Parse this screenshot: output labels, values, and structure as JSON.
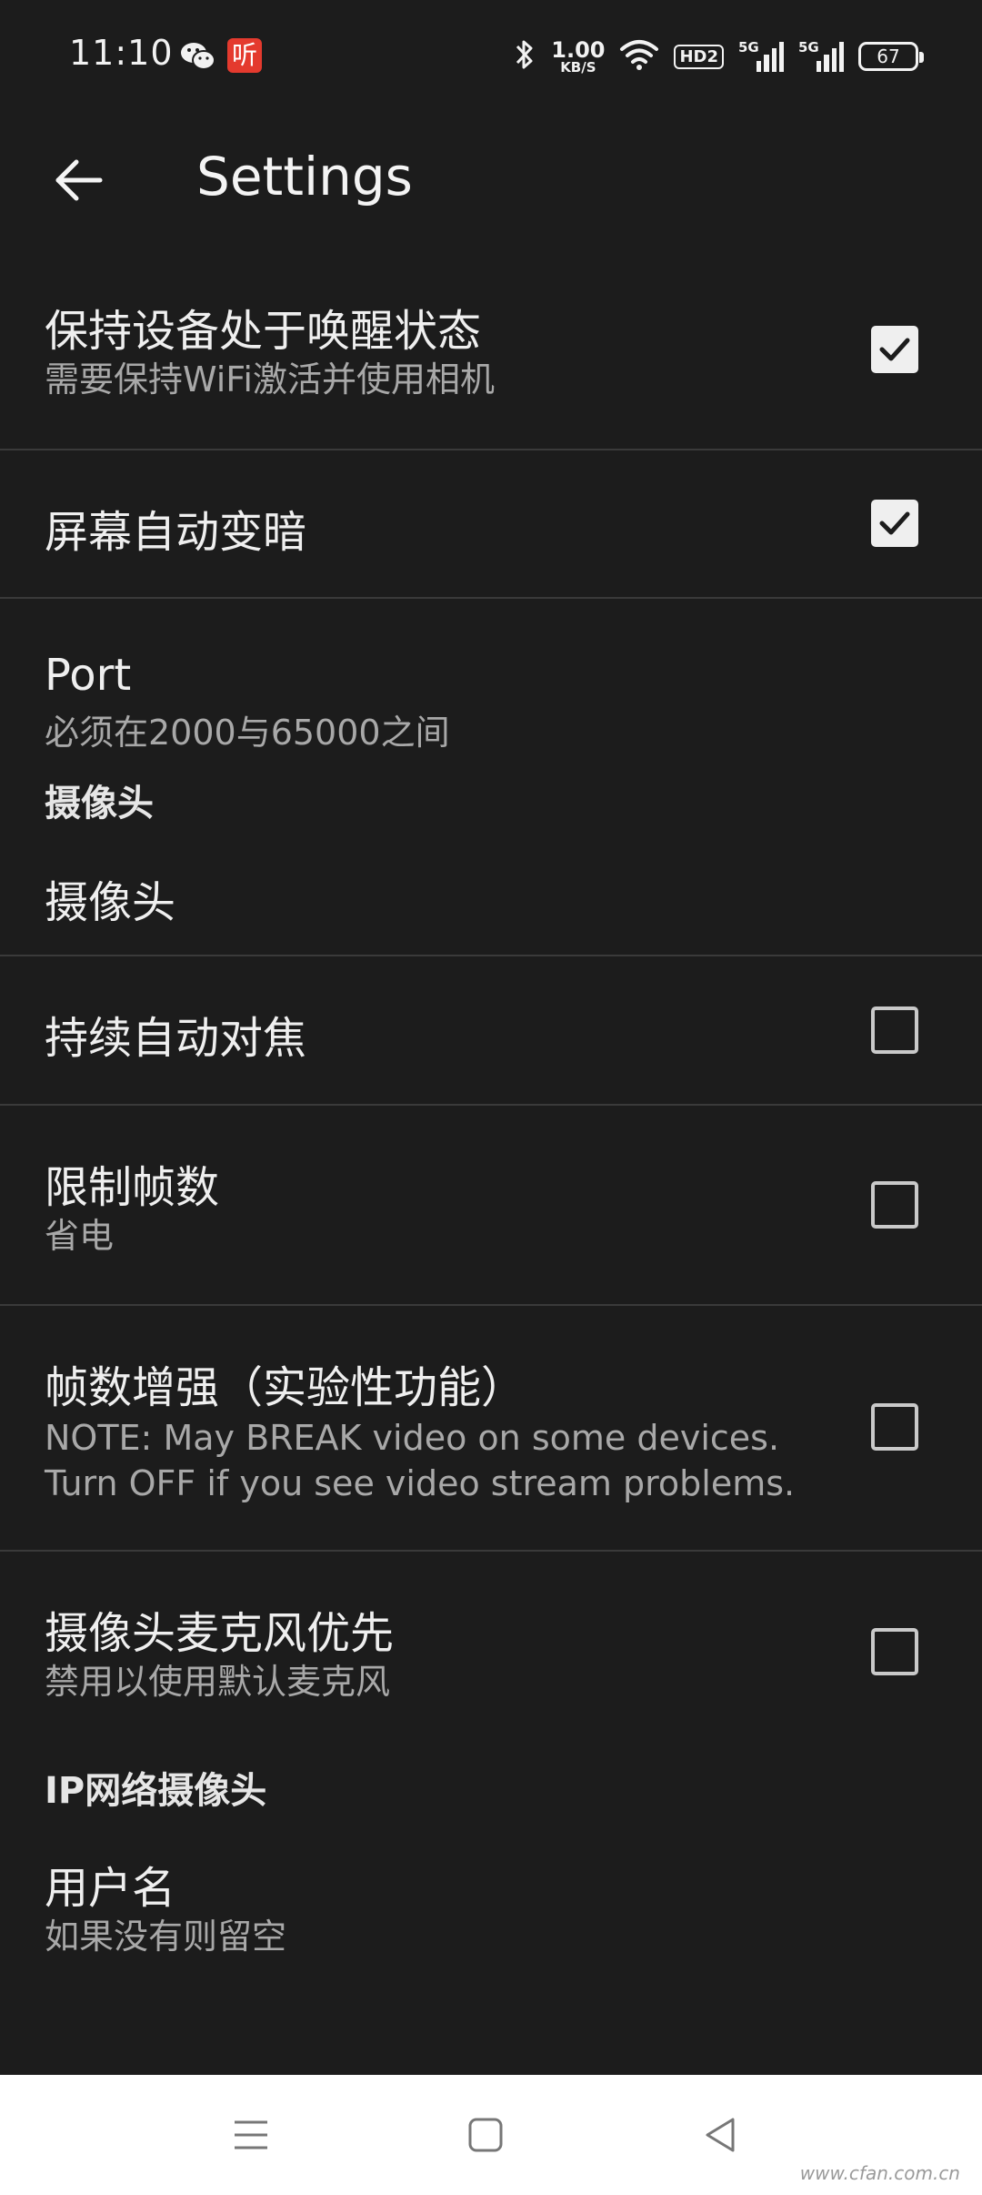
{
  "status_bar": {
    "time": "11:10",
    "app_icon_listen": "听",
    "net_speed_value": "1.00",
    "net_speed_unit": "KB/S",
    "hd_label": "HD2",
    "sim1_label": "5G",
    "sim2_label": "5G",
    "battery": "67",
    "icons": [
      "wechat-icon",
      "listen-app-icon",
      "bluetooth-icon",
      "wifi-icon",
      "signal-icon",
      "battery-icon"
    ]
  },
  "app_bar": {
    "title": "Settings",
    "back_icon": "arrow-left-icon"
  },
  "settings": {
    "keep_awake": {
      "title": "保持设备处于唤醒状态",
      "summary": "需要保持WiFi激活并使用相机",
      "checked": true
    },
    "auto_dim": {
      "title": "屏幕自动变暗",
      "checked": true
    },
    "port": {
      "title": "Port",
      "summary": "必须在2000与65000之间"
    },
    "camera_section": "摄像头",
    "camera": {
      "title": "摄像头"
    },
    "continuous_focus": {
      "title": "持续自动对焦",
      "checked": false
    },
    "limit_fps": {
      "title": "限制帧数",
      "summary": "省电",
      "checked": false
    },
    "fps_boost": {
      "title": "帧数增强（实验性功能）",
      "summary_line1": "NOTE: May BREAK video on some devices.",
      "summary_line2": "Turn OFF if you see video stream problems.",
      "checked": false
    },
    "camera_mic": {
      "title": "摄像头麦克风优先",
      "summary": "禁用以使用默认麦克风",
      "checked": false
    },
    "ip_section": "IP网络摄像头",
    "username": {
      "title": "用户名",
      "summary": "如果没有则留空"
    }
  },
  "nav_bar": {
    "icons": [
      "menu-icon",
      "home-square-icon",
      "back-triangle-icon"
    ],
    "watermark": "www.cfan.com.cn"
  },
  "colors": {
    "background": "#1c1c1c",
    "divider": "#3a3a3a",
    "text_primary": "#efefef",
    "text_secondary": "#a8a8a8",
    "nav_bar": "#ffffff",
    "listen_badge": "#e43a2e"
  }
}
